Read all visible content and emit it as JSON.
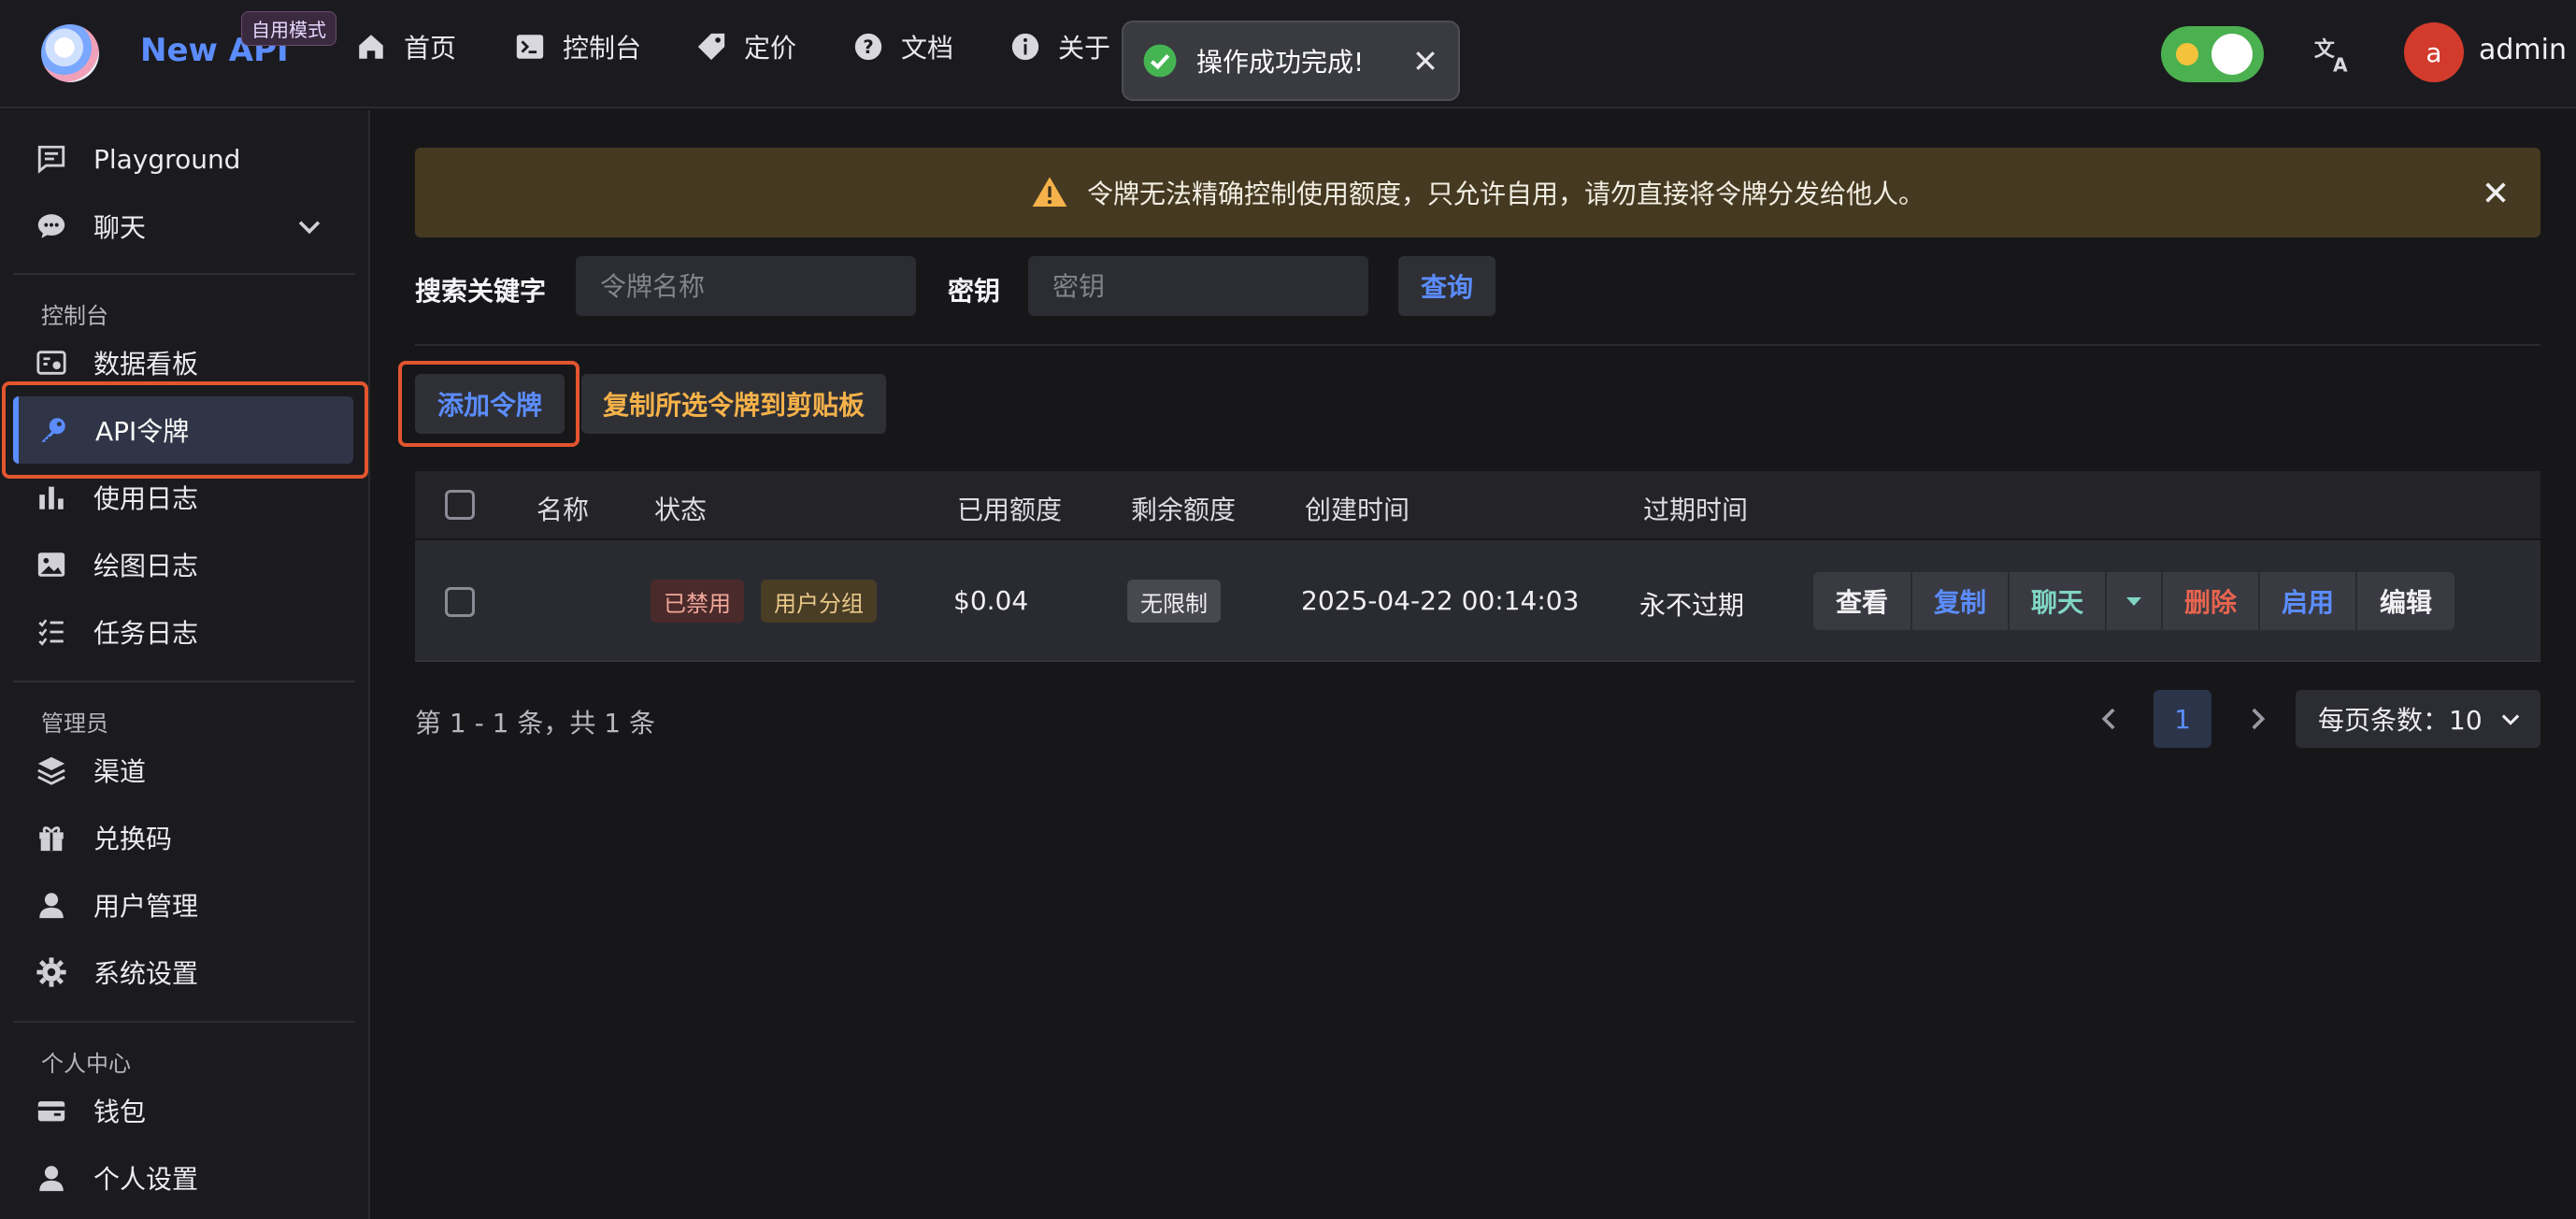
{
  "app": {
    "brand": "New API",
    "mode_badge": "自用模式"
  },
  "nav": [
    {
      "label": "首页",
      "icon": "home-icon"
    },
    {
      "label": "控制台",
      "icon": "terminal-icon"
    },
    {
      "label": "定价",
      "icon": "tag-icon"
    },
    {
      "label": "文档",
      "icon": "help-icon"
    },
    {
      "label": "关于",
      "icon": "info-icon"
    }
  ],
  "toast": {
    "message": "操作成功完成!"
  },
  "user": {
    "avatar_letter": "a",
    "name": "admin"
  },
  "sidebar": {
    "top_items": [
      {
        "label": "Playground",
        "icon": "message-square-icon"
      },
      {
        "label": "聊天",
        "icon": "chat-bubble-icon"
      }
    ],
    "console_section": "控制台",
    "console_items": [
      {
        "label": "数据看板",
        "icon": "dashboard-icon"
      },
      {
        "label": "API令牌",
        "icon": "key-icon"
      },
      {
        "label": "使用日志",
        "icon": "bar-chart-icon"
      },
      {
        "label": "绘图日志",
        "icon": "image-icon"
      },
      {
        "label": "任务日志",
        "icon": "list-icon"
      }
    ],
    "admin_section": "管理员",
    "admin_items": [
      {
        "label": "渠道",
        "icon": "layers-icon"
      },
      {
        "label": "兑换码",
        "icon": "gift-icon"
      },
      {
        "label": "用户管理",
        "icon": "user-icon"
      },
      {
        "label": "系统设置",
        "icon": "gear-icon"
      }
    ],
    "personal_section": "个人中心",
    "personal_items": [
      {
        "label": "钱包",
        "icon": "wallet-icon"
      },
      {
        "label": "个人设置",
        "icon": "user-icon"
      }
    ]
  },
  "banner": {
    "text": "令牌无法精确控制使用额度，只允许自用，请勿直接将令牌分发给他人。"
  },
  "search": {
    "keyword_label": "搜索关键字",
    "name_placeholder": "令牌名称",
    "key_label": "密钥",
    "key_placeholder": "密钥",
    "query_button": "查询"
  },
  "toolbar": {
    "add_token": "添加令牌",
    "copy_selected": "复制所选令牌到剪贴板"
  },
  "table": {
    "headers": [
      "名称",
      "状态",
      "已用额度",
      "剩余额度",
      "创建时间",
      "过期时间"
    ],
    "rows": [
      {
        "name": "",
        "status": "已禁用",
        "group": "用户分组",
        "used": "$0.04",
        "remaining": "无限制",
        "created": "2025-04-22 00:14:03",
        "expires": "永不过期",
        "actions": {
          "view": "查看",
          "copy": "复制",
          "chat": "聊天",
          "delete": "删除",
          "enable": "启用",
          "edit": "编辑"
        }
      }
    ]
  },
  "pagination": {
    "summary": "第 1 - 1 条，共 1 条",
    "current_page": "1",
    "page_size_label": "每页条数：10"
  },
  "colors": {
    "accent_blue": "#5b8dff",
    "warning_orange": "#f6b24a",
    "success_green": "#4bb04f",
    "danger_red": "#e8644f",
    "highlight_box": "#e2552f"
  }
}
